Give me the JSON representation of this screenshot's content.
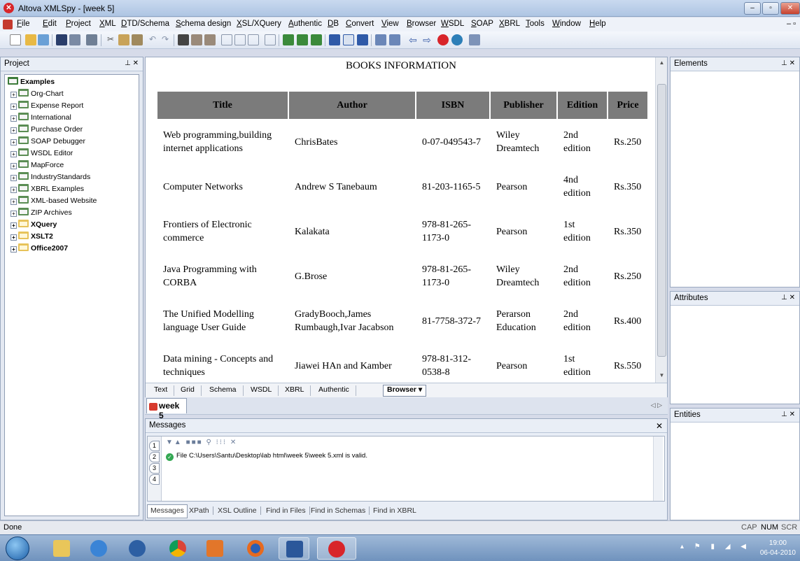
{
  "window": {
    "title": "Altova XMLSpy - [week 5]"
  },
  "menu": [
    "File",
    "Edit",
    "Project",
    "XML",
    "DTD/Schema",
    "Schema design",
    "XSL/XQuery",
    "Authentic",
    "DB",
    "Convert",
    "View",
    "Browser",
    "WSDL",
    "SOAP",
    "XBRL",
    "Tools",
    "Window",
    "Help"
  ],
  "project": {
    "title": "Project",
    "root": "Examples",
    "items": [
      "Org-Chart",
      "Expense Report",
      "International",
      "Purchase Order",
      "SOAP Debugger",
      "WSDL Editor",
      "MapForce",
      "IndustryStandards",
      "XBRL Examples",
      "XML-based Website",
      "ZIP Archives",
      "XQuery",
      "XSLT2",
      "Office2007"
    ]
  },
  "doc": {
    "title": "BOOKS INFORMATION",
    "headers": [
      "Title",
      "Author",
      "ISBN",
      "Publisher",
      "Edition",
      "Price"
    ],
    "rows": [
      [
        "Web programming,building internet applications",
        "ChrisBates",
        "0-07-049543-7",
        "Wiley Dreamtech",
        "2nd edition",
        "Rs.250"
      ],
      [
        "Computer Networks",
        "Andrew S Tanebaum",
        "81-203-1165-5",
        "Pearson",
        "4nd edition",
        "Rs.350"
      ],
      [
        "Frontiers of Electronic commerce",
        "Kalakata",
        "978-81-265-1173-0",
        "Pearson",
        "1st edition",
        "Rs.350"
      ],
      [
        "Java Programming with CORBA",
        "G.Brose",
        "978-81-265-1173-0",
        "Wiley Dreamtech",
        "2nd edition",
        "Rs.250"
      ],
      [
        "The Unified Modelling language User Guide",
        "GradyBooch,James Rumbaugh,Ivar Jacabson",
        "81-7758-372-7",
        "Perarson Education",
        "2nd edition",
        "Rs.400"
      ],
      [
        "Data mining - Concepts and techniques",
        "Jiawei HAn and Kamber",
        "978-81-312-0538-8",
        "Pearson",
        "1st edition",
        "Rs.550"
      ]
    ]
  },
  "view_tabs": [
    "Text",
    "Grid",
    "Schema",
    "WSDL",
    "XBRL",
    "Authentic",
    "Browser ▾"
  ],
  "doc_tab": "week 5",
  "messages": {
    "title": "Messages",
    "line": "File C:\\Users\\Santu\\Desktop\\lab html\\week 5\\week 5.xml is valid.",
    "side_tabs": [
      "1",
      "2",
      "3",
      "4"
    ],
    "tabs": [
      "Messages",
      "XPath",
      "XSL Outline",
      "Find in Files",
      "Find in Schemas",
      "Find in XBRL"
    ]
  },
  "panels": {
    "elements": "Elements",
    "attributes": "Attributes",
    "entities": "Entities"
  },
  "status": {
    "text": "Done",
    "cap": "CAP",
    "num": "NUM",
    "scr": "SCR"
  },
  "clock": {
    "time": "19:00",
    "date": "06-04-2010"
  }
}
